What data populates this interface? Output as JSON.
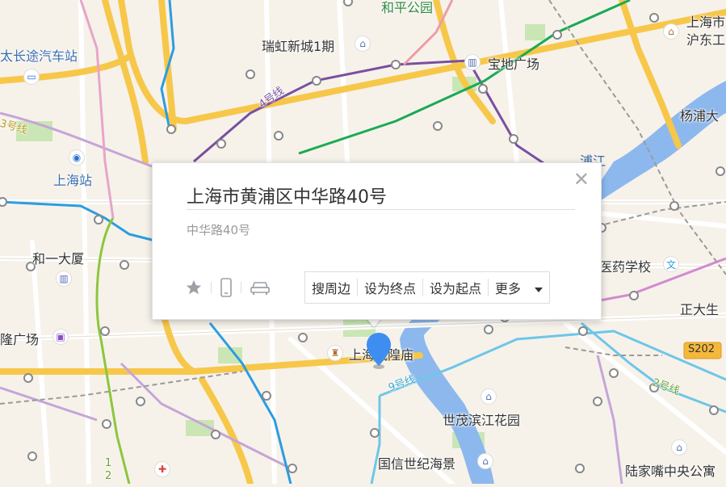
{
  "popup": {
    "title": "上海市黄浦区中华路40号",
    "address": "中华路40号",
    "close_icon": "close-icon",
    "tools": [
      "star-icon",
      "phone-icon",
      "car-icon"
    ],
    "actions": {
      "nearby": "搜周边",
      "set_destination": "设为终点",
      "set_origin": "设为起点",
      "more": "更多"
    }
  },
  "map": {
    "labels": {
      "heping_park": "和平公园",
      "ruihong": "瑞虹新城1期",
      "baodi": "宝地广场",
      "shanghai_city": "上海市",
      "hudong": "沪东工",
      "yangpu": "杨浦大",
      "long_distance": "太长途汽车站",
      "shanghai_station": "上海站",
      "heyi": "和一大厦",
      "long_plaza": "隆广场",
      "medical_school": "医药学校",
      "zhengda": "正大生",
      "chenghuangmiao": "上海城隍庙",
      "shimao": "世茂滨江花园",
      "guoxin": "国信世纪海景",
      "lujiazui": "陆家嘴中央公寓",
      "river_pujiang": "浦江",
      "line4": "4号线",
      "line3": "3号线",
      "line9": "9号线",
      "line2": "2号线",
      "s202": "S202",
      "line_1": "1",
      "line_2": "2"
    },
    "line_colors": {
      "line2": "#8cc63e",
      "line3": "#f5d335",
      "line4": "#7a4fa0",
      "line8": "#2b9de0",
      "line9": "#6ec6e8",
      "line10": "#c6a5d8",
      "line12": "#0f8a73",
      "line13": "#e8a5c8",
      "road_major": "#f7c74a",
      "river": "#8cb8ee"
    }
  }
}
